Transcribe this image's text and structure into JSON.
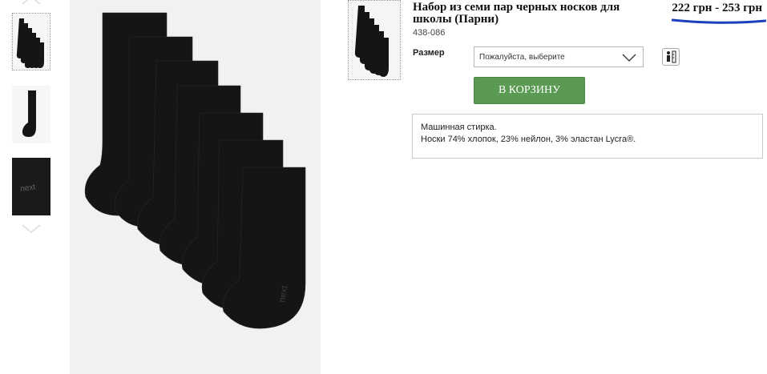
{
  "product": {
    "title": "Набор из семи пар черных носков для школы (Парни)",
    "code": "438-086",
    "price": "222 грн - 253 грн"
  },
  "size": {
    "label": "Размер",
    "selected": "Пожалуйста, выберите"
  },
  "cart_button": "В КОРЗИНУ",
  "description": {
    "line1": "Машинная стирка.",
    "line2": "Носки 74% хлопок, 23% нейлон, 3% эластан Lycra®."
  },
  "thumbnails": [
    {
      "icon": "sock-pack-thumbnail",
      "active": true
    },
    {
      "icon": "single-sock-thumbnail",
      "active": false
    },
    {
      "icon": "next-logo-closeup-thumbnail",
      "active": false
    }
  ],
  "colors": {
    "cart_green": "#5a9a52",
    "price_underline": "#1a3fbf",
    "sock": "#151515"
  }
}
